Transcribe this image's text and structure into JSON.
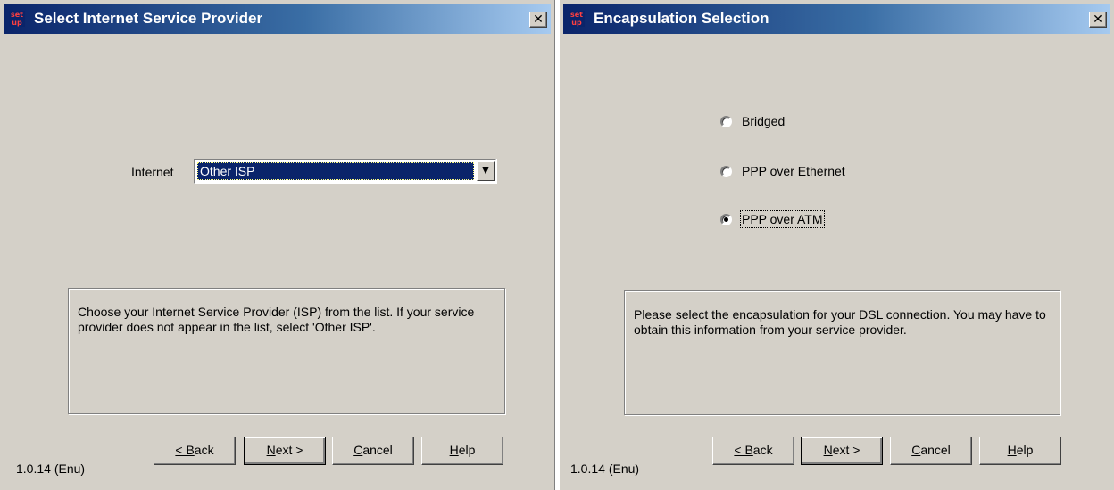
{
  "dialog1": {
    "title": "Select Internet Service Provider",
    "app_icon": "set up",
    "close_glyph": "✕",
    "isp_label": "Internet",
    "isp_select_value": "Other ISP",
    "help_text": "Choose your Internet Service Provider (ISP) from the list. If your service provider does not appear in the list, select 'Other ISP'.",
    "buttons": {
      "back": "< Back",
      "next": "Next >",
      "cancel": "Cancel",
      "help": "Help"
    },
    "version": "1.0.14 (Enu)"
  },
  "dialog2": {
    "title": "Encapsulation Selection",
    "app_icon": "set up",
    "close_glyph": "✕",
    "options": [
      {
        "label": "Bridged",
        "selected": false
      },
      {
        "label": "PPP over Ethernet",
        "selected": false
      },
      {
        "label": "PPP over ATM",
        "selected": true
      }
    ],
    "help_text": "Please select the encapsulation for your DSL connection. You may have to obtain this information from your service provider.",
    "buttons": {
      "back": "< Back",
      "next": "Next >",
      "cancel": "Cancel",
      "help": "Help"
    },
    "version": "1.0.14 (Enu)"
  },
  "icons": {
    "close": "close-icon",
    "dropdown": "chevron-down-icon",
    "app": "setup-app-icon"
  }
}
